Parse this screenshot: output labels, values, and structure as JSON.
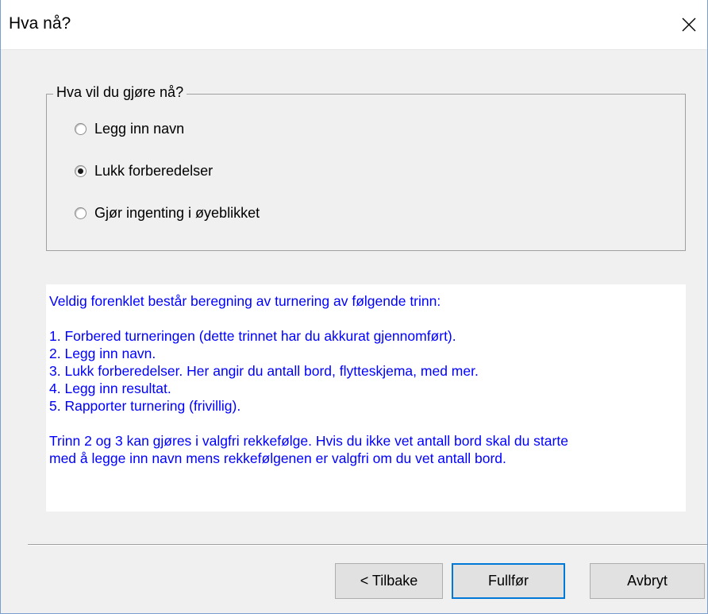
{
  "window": {
    "title": "Hva nå?",
    "close_icon": "close-icon"
  },
  "choice_group": {
    "legend": "Hva vil du gjøre nå?",
    "options": [
      {
        "label": "Legg inn navn",
        "checked": false
      },
      {
        "label": "Lukk forberedelser",
        "checked": true
      },
      {
        "label": "Gjør ingenting i øyeblikket",
        "checked": false
      }
    ]
  },
  "info": {
    "intro": "Veldig forenklet består beregning av turnering av følgende trinn:",
    "steps": [
      "1. Forbered turneringen (dette trinnet har du akkurat gjennomført).",
      "2. Legg inn navn.",
      "3. Lukk forberedelser. Her angir du antall bord, flytteskjema, med mer.",
      "4. Legg inn resultat.",
      "5. Rapporter turnering (frivillig)."
    ],
    "note_line1": "Trinn 2 og 3 kan gjøres i valgfri rekkefølge. Hvis du ikke vet antall bord skal du starte",
    "note_line2": "med å legge inn navn mens rekkefølgenen er valgfri om du vet antall bord.",
    "text_color": "#0000ff"
  },
  "buttons": {
    "back": "< Tilbake",
    "finish": "Fullfør",
    "cancel": "Avbryt"
  }
}
